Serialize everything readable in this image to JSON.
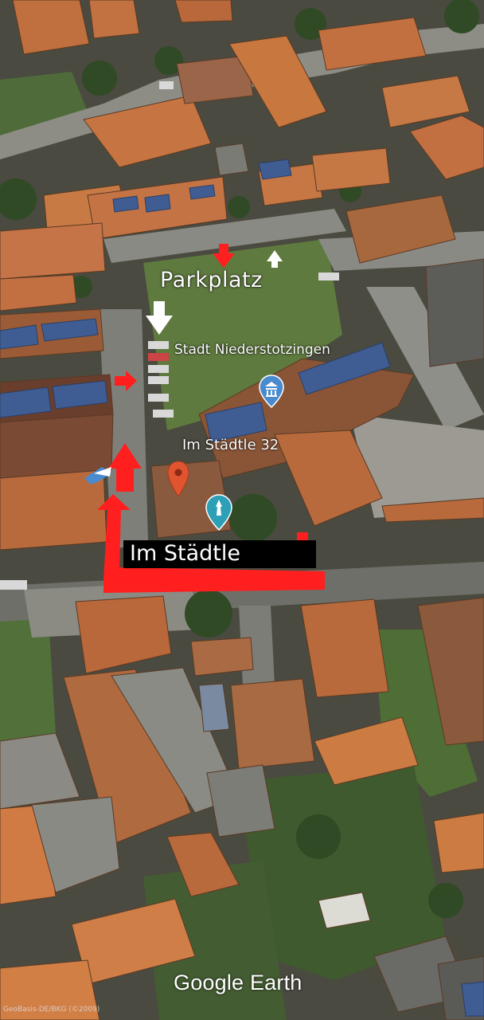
{
  "labels": {
    "parking": "Parkplatz",
    "town_hall": "Stadt Niederstotzingen",
    "address": "Im Städtle 32",
    "street": "Im Städtle"
  },
  "brand": "Google Earth",
  "attribution": "GeoBasis-DE/BKG (©2009)",
  "icons": {
    "town_hall": "landmark-pin-icon",
    "address": "red-location-pin-icon",
    "poi": "monument-pin-icon"
  },
  "colors": {
    "route_arrow": "#ff1f1f",
    "roof": "#b8683a",
    "pin_blue": "#4a8bd0",
    "pin_teal": "#2d9fb6",
    "pin_red": "#e0552f"
  }
}
